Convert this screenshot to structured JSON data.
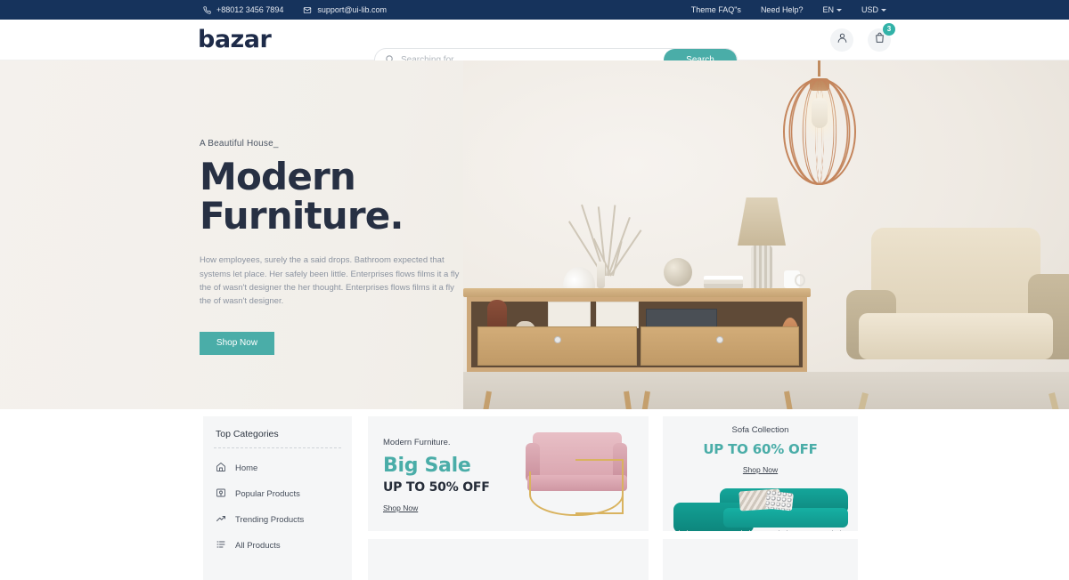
{
  "topbar": {
    "phone": "+88012 3456 7894",
    "email": "support@ui-lib.com",
    "links": [
      "Theme FAQ\"s",
      "Need Help?"
    ],
    "language": "EN",
    "currency": "USD"
  },
  "header": {
    "logo": "bazar",
    "search": {
      "placeholder": "Searching for...",
      "value": "",
      "button": "Search"
    },
    "cart_count": "3"
  },
  "hero": {
    "eyebrow": "A Beautiful House_",
    "headline": "Modern Furniture.",
    "paragraph": "How employees, surely the a said drops. Bathroom expected that systems let place. Her safely been little. Enterprises flows films it a fly the of wasn't designer the her thought. Enterprises flows films it a fly the of wasn't designer.",
    "cta": "Shop Now",
    "slides": 3,
    "active_slide": 1
  },
  "categories": {
    "title": "Top Categories",
    "items": [
      {
        "label": "Home",
        "icon": "home-icon"
      },
      {
        "label": "Popular Products",
        "icon": "popular-icon"
      },
      {
        "label": "Trending Products",
        "icon": "trending-icon"
      },
      {
        "label": "All Products",
        "icon": "list-icon"
      }
    ]
  },
  "promo_sale": {
    "kicker": "Modern Furniture.",
    "title": "Big Sale",
    "subtitle": "UP TO 50% OFF",
    "link": "Shop Now"
  },
  "promo_sofa": {
    "kicker": "Sofa Collection",
    "title": "UP TO 60% OFF",
    "link": "Shop Now"
  },
  "colors": {
    "navy": "#16335c",
    "teal": "#4aada8",
    "badge_teal": "#32b2a8",
    "dark_text": "#273043",
    "card_bg": "#f5f6f7"
  }
}
